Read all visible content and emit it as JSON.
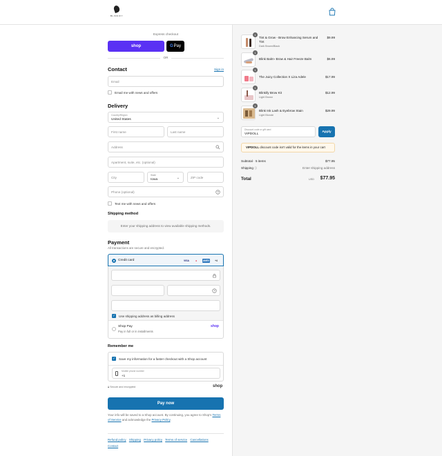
{
  "header": {
    "brand": "BLINKIFY",
    "cart_icon": "shopping-bag-icon"
  },
  "express": {
    "label": "Express checkout",
    "shop_pay": "shop",
    "google_pay": "Pay",
    "google_g": "G",
    "or": "OR"
  },
  "contact": {
    "title": "Contact",
    "sign_in": "Sign in",
    "email_placeholder": "Email",
    "email_news": "Email me with news and offers"
  },
  "delivery": {
    "title": "Delivery",
    "country_label": "Country/Region",
    "country_value": "United States",
    "first_name": "First name",
    "last_name": "Last name",
    "address": "Address",
    "apartment": "Apartment, suite, etc. (optional)",
    "city": "City",
    "state_label": "State",
    "state_value": "Iowa",
    "zip": "ZIP code",
    "phone": "Phone (optional)",
    "text_news": "Text me with news and offers"
  },
  "shipping_method": {
    "title": "Shipping method",
    "message": "Enter your shipping address to view available shipping methods."
  },
  "payment": {
    "title": "Payment",
    "subtitle": "All transactions are secure and encrypted.",
    "credit_card": "Credit card",
    "brands": [
      "VISA",
      "MC",
      "AMEX",
      "+4"
    ],
    "billing_same": "Use shipping address as billing address",
    "shop_pay_title": "Shop Pay",
    "shop_pay_sub": "Pay in full or in installments",
    "shop_pay_logo": "shop"
  },
  "remember": {
    "title": "Remember me",
    "save_info": "Save my information for a faster checkout with a Shop account",
    "phone_label": "Mobile phone number",
    "phone_value": "+1",
    "secure": "Secure and encrypted",
    "shop_word": "shop"
  },
  "pay_now": "Pay now",
  "legal": {
    "text": "Your info will be saved to a Shop account. By continuing, you agree to Shop's",
    "terms": "Terms of Service",
    "and": "and acknowledge the",
    "privacy": "Privacy Policy",
    "dot": "."
  },
  "footer": {
    "links": [
      "Refund policy",
      "Shipping",
      "Privacy policy",
      "Terms of service",
      "Cancellations",
      "Contact"
    ]
  },
  "cart": {
    "items": [
      {
        "qty": "1",
        "name": "Tint & Grow - Brow Enhancing Serum and Tint",
        "variant": "Dark Brown/Black",
        "price": "$9.99"
      },
      {
        "qty": "1",
        "name": "Blink Balm- Brow & Hair Freeze Balm",
        "variant": "",
        "price": "$6.99"
      },
      {
        "qty": "1",
        "name": "The Juicy Collection X Liza Adele",
        "variant": "",
        "price": "$17.99"
      },
      {
        "qty": "1",
        "name": "Blinkify Brow Kit",
        "variant": "Light Brown",
        "price": "$12.99"
      },
      {
        "qty": "1",
        "name": "Blink Ink Lash & Eyebrow Stain",
        "variant": "Light Blonde",
        "price": "$29.99"
      }
    ],
    "discount_label": "Discount code or gift card",
    "discount_value": "VIPDOLL",
    "apply": "Apply",
    "warning_code": "VIPDOLL",
    "warning_text": "discount code isn't valid for the items in your cart",
    "subtotal_label": "Subtotal · 5 items",
    "subtotal_value": "$77.95",
    "shipping_label": "Shipping",
    "shipping_value": "Enter shipping address",
    "total_label": "Total",
    "total_currency": "USD",
    "total_value": "$77.95"
  },
  "colors": {
    "accent": "#1773b0",
    "shop_purple": "#5a31f4",
    "warning_bg": "#fff8ec"
  }
}
